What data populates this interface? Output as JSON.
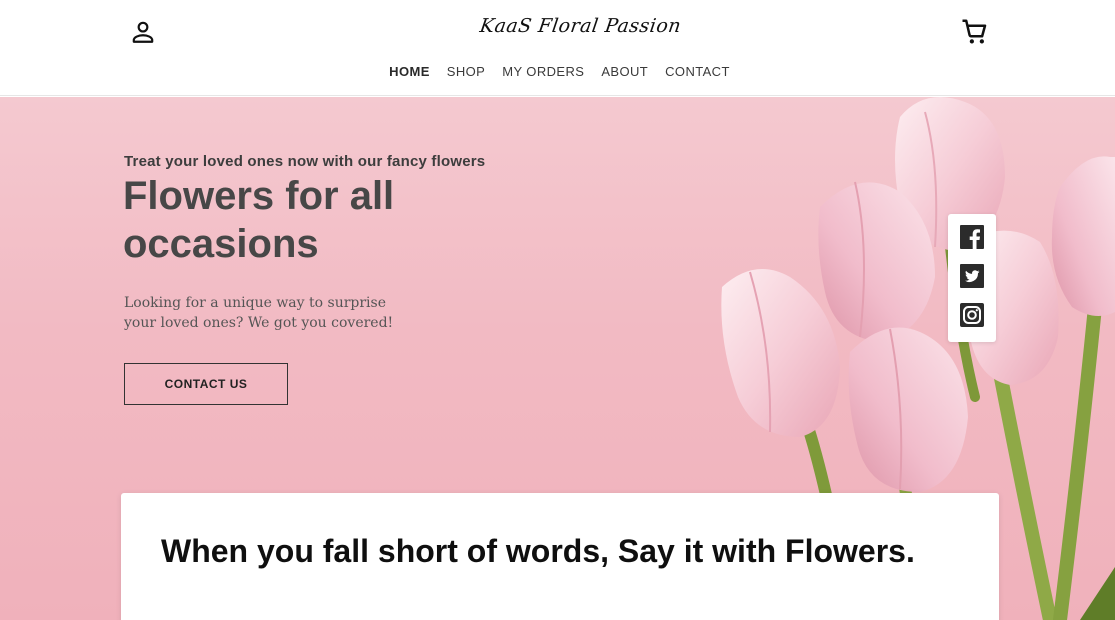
{
  "header": {
    "logo_text": "KaaS Floral Passion",
    "account_icon": "user-icon",
    "cart_icon": "shopping-cart-icon"
  },
  "nav": {
    "items": [
      {
        "label": "HOME",
        "active": true
      },
      {
        "label": "SHOP"
      },
      {
        "label": "MY ORDERS"
      },
      {
        "label": "ABOUT"
      },
      {
        "label": "CONTACT"
      }
    ]
  },
  "hero": {
    "eyebrow": "Treat your loved ones now with our fancy flowers",
    "headline": "Flowers for all occasions",
    "intro": "Looking for a unique way to surprise your loved ones? We got you covered!",
    "cta_label": "CONTACT US",
    "background_color": "#f2bac3"
  },
  "social": {
    "icons": [
      "facebook-icon",
      "twitter-icon",
      "instagram-icon"
    ]
  },
  "card": {
    "title": "When you fall short of words, Say it with Flowers."
  }
}
